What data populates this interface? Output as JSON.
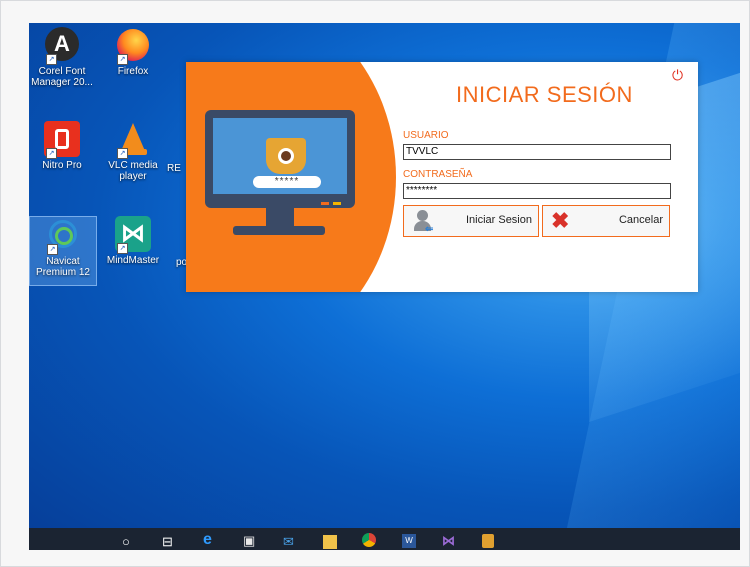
{
  "desktop_icons": [
    {
      "id": "corel",
      "label": "Corel Font Manager 20...",
      "letter": "A"
    },
    {
      "id": "firefox",
      "label": "Firefox"
    },
    {
      "id": "nitro",
      "label": "Nitro Pro"
    },
    {
      "id": "vlc",
      "label": "VLC media player"
    },
    {
      "id": "navicat",
      "label": "Navicat Premium 12"
    },
    {
      "id": "mindmaster",
      "label": "MindMaster"
    }
  ],
  "partial_labels": {
    "re": "RE",
    "po": "po"
  },
  "login": {
    "title": "INICIAR SESIÓN",
    "user_label": "USUARIO",
    "user_value": "TVVLC",
    "pass_label": "CONTRASEÑA",
    "pass_value": "********",
    "login_button": "Iniciar Sesion",
    "cancel_button": "Cancelar",
    "monitor_password": "*****"
  },
  "taskbar": {
    "items": [
      "search-icon",
      "task-view-icon",
      "edge-icon",
      "store-icon",
      "mail-icon",
      "file-explorer-icon",
      "chrome-icon",
      "word-icon",
      "visual-studio-icon",
      "app-icon"
    ]
  },
  "colors": {
    "accent": "#f26b1d",
    "taskbar": "#1b2432"
  }
}
